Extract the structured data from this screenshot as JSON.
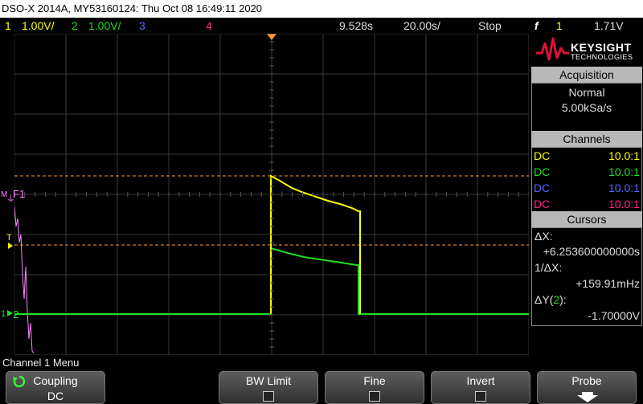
{
  "title": "DSO-X 2014A, MY53160124: Thu Oct 08 16:49:11 2020",
  "status": {
    "ch1": {
      "num": "1",
      "scale": "1.00V/"
    },
    "ch2": {
      "num": "2",
      "scale": "1.00V/"
    },
    "ch3": {
      "num": "3"
    },
    "ch4": {
      "num": "4"
    },
    "time_position": "9.528s",
    "time_scale": "20.00s/",
    "run_state": "Stop",
    "trigger_symbol": "f",
    "trigger_source": "1",
    "trigger_level": "1.71V"
  },
  "colors": {
    "ch1": "#ffff00",
    "ch2": "#22dd22",
    "ch3": "#5566ff",
    "ch4": "#ff2288",
    "math": "#ff88ff",
    "cursor": "#ff9933",
    "grid": "#3a3a3a",
    "logo_red": "#e0103a"
  },
  "markers": {
    "ch1_marker": "1",
    "ch2_marker": "2",
    "math_marker": "M",
    "math_label": "F1",
    "trigger_level_marker": "T"
  },
  "brand": {
    "name": "KEYSIGHT",
    "sub": "TECHNOLOGIES"
  },
  "acquisition": {
    "header": "Acquisition",
    "mode": "Normal",
    "rate": "5.00kSa/s"
  },
  "channels": {
    "header": "Channels",
    "rows": [
      {
        "coupling": "DC",
        "probe": "10.0:1"
      },
      {
        "coupling": "DC",
        "probe": "10.0:1"
      },
      {
        "coupling": "DC",
        "probe": "10.0:1"
      },
      {
        "coupling": "DC",
        "probe": "10.0:1"
      }
    ]
  },
  "cursors": {
    "header": "Cursors",
    "dx_label": "ΔX:",
    "dx_value": "+6.253600000000s",
    "inv_dx_label": "1/ΔX:",
    "inv_dx_value": "+159.91mHz",
    "dy_label_prefix": "ΔY(",
    "dy_channel": "2",
    "dy_label_suffix": "):",
    "dy_value": "-1.70000V"
  },
  "menu": {
    "title": "Channel 1 Menu",
    "softkeys": [
      {
        "label": "Coupling",
        "value": "DC"
      },
      {
        "label": "BW Limit"
      },
      {
        "label": "Fine"
      },
      {
        "label": "Invert"
      },
      {
        "label": "Probe"
      }
    ]
  }
}
